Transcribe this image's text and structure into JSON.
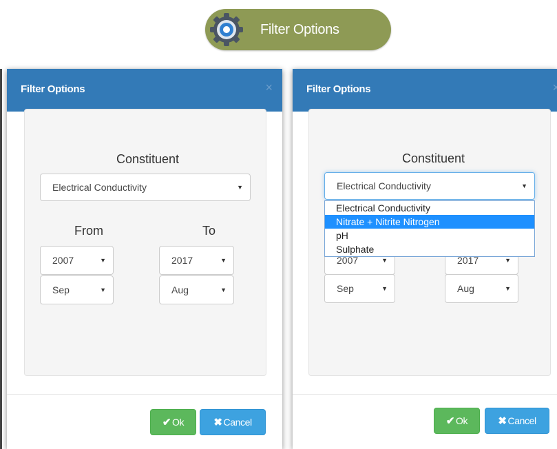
{
  "top_button": {
    "label": "Filter Options",
    "icon": "gear-icon"
  },
  "dialogs": [
    {
      "title": "Filter Options",
      "close": "×",
      "constituent_label": "Constituent",
      "constituent_value": "Electrical Conductivity",
      "from_label": "From",
      "to_label": "To",
      "from_year": "2007",
      "from_month": "Sep",
      "to_year": "2017",
      "to_month": "Aug",
      "ok_label": "Ok",
      "cancel_label": "Cancel"
    },
    {
      "title": "Filter Options",
      "close": "×",
      "constituent_label": "Constituent",
      "constituent_value": "Electrical Conductivity",
      "dropdown_open": true,
      "options": [
        "Electrical Conductivity",
        "Nitrate + Nitrite Nitrogen",
        "pH",
        "Sulphate"
      ],
      "highlighted_option": "Nitrate + Nitrite Nitrogen",
      "from_year": "2007",
      "from_month": "Sep",
      "to_year": "2017",
      "to_month": "Aug",
      "ok_label": "Ok",
      "cancel_label": "Cancel"
    }
  ],
  "colors": {
    "header": "#337ab7",
    "pill": "#8e9a55",
    "ok": "#5cb85c",
    "cancel": "#3da2e0",
    "highlight": "#1e90ff"
  }
}
